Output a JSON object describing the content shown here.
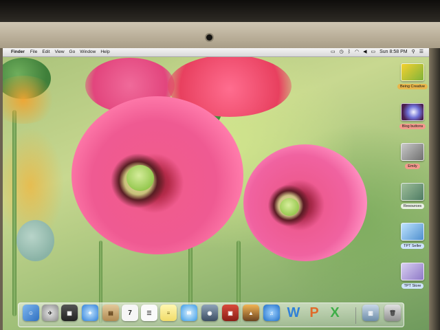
{
  "menubar": {
    "apple_glyph": "",
    "app_name": "Finder",
    "items": [
      "File",
      "Edit",
      "View",
      "Go",
      "Window",
      "Help"
    ],
    "clock": "Sun 8:58 PM"
  },
  "desktop_icons": [
    {
      "label": "Being Creative",
      "style": "highlight"
    },
    {
      "label": "Blog buttons",
      "style": "red"
    },
    {
      "label": "Emily",
      "style": "red"
    },
    {
      "label": "Resources",
      "style": "plain"
    },
    {
      "label": "TPT Seller",
      "style": "blue"
    },
    {
      "label": "TPT Store",
      "style": "blue"
    }
  ],
  "dock": {
    "calendar_day": "7",
    "word_letter": "W",
    "powerpoint_letter": "P",
    "excel_letter": "X"
  },
  "colors": {
    "menubar": "#e6e6e6",
    "poppy_pink": "#e8457a",
    "poppy_center": "#9ccf55",
    "wallpaper_green": "#a9c27a"
  }
}
